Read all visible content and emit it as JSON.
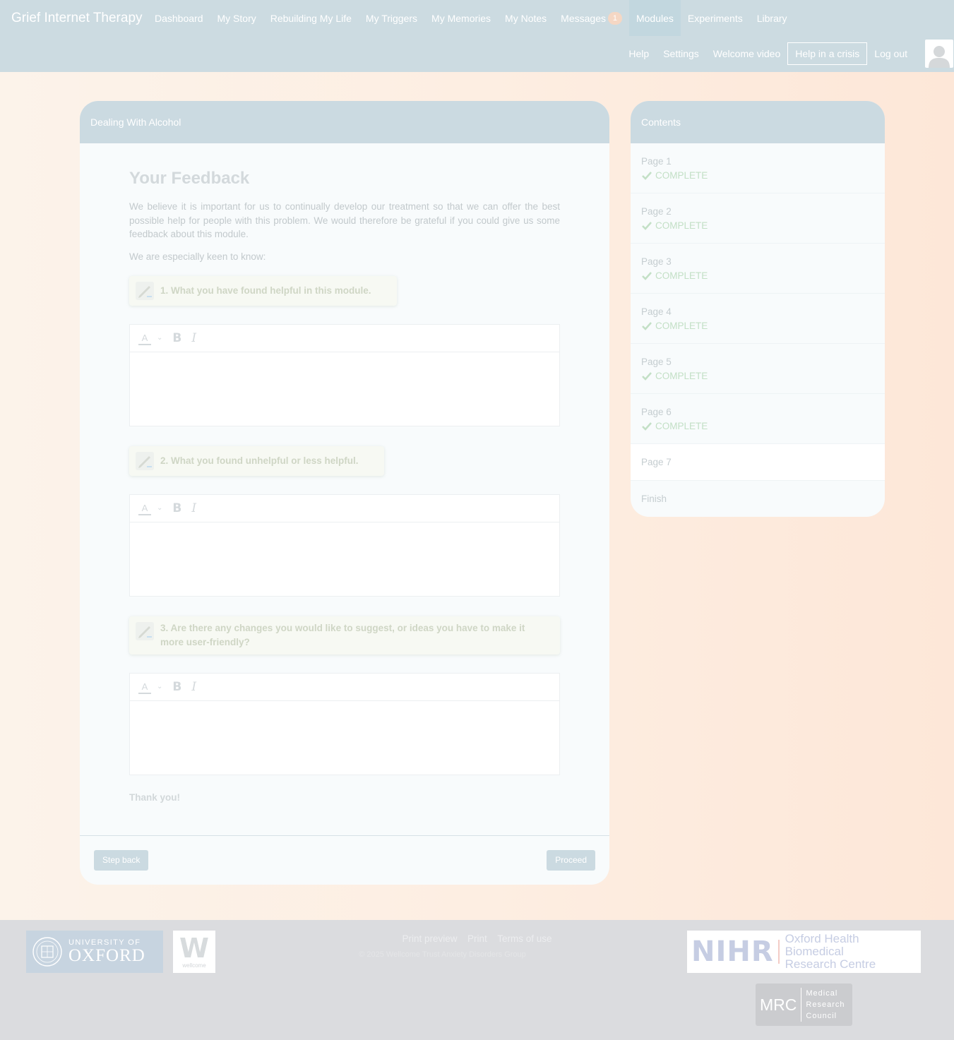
{
  "header": {
    "brand": "Grief Internet Therapy",
    "nav": [
      {
        "label": "Dashboard"
      },
      {
        "label": "My Story"
      },
      {
        "label": "Rebuilding My Life"
      },
      {
        "label": "My Triggers"
      },
      {
        "label": "My Memories"
      },
      {
        "label": "My Notes"
      },
      {
        "label": "Messages",
        "badge": "1"
      },
      {
        "label": "Modules",
        "active": true
      },
      {
        "label": "Experiments"
      },
      {
        "label": "Library"
      }
    ],
    "subnav": [
      {
        "label": "Help"
      },
      {
        "label": "Settings"
      },
      {
        "label": "Welcome video"
      },
      {
        "label": "Help in a crisis"
      },
      {
        "label": "Log out"
      }
    ]
  },
  "module": {
    "title": "Dealing With Alcohol",
    "page_title": "Your Feedback",
    "intro": "We believe it is important for us to continually develop our treatment so that we can offer the best possible help for people with this problem. We would therefore be grateful if you could give us some feedback about this module.",
    "keen": "We are especially keen to know:",
    "questions": [
      {
        "text": "1. What you have found helpful in this module."
      },
      {
        "text": "2. What you found unhelpful or less helpful."
      },
      {
        "text": "3. Are there any changes you would like to suggest, or ideas you have to make it more user-friendly?"
      }
    ],
    "toolbar": {
      "color_label": "A",
      "bold_label": "B",
      "italic_label": "I"
    },
    "thanks": "Thank you!",
    "back_label": "Step back",
    "proceed_label": "Proceed"
  },
  "contents": {
    "title": "Contents",
    "items": [
      {
        "label": "Page 1",
        "status": "COMPLETE"
      },
      {
        "label": "Page 2",
        "status": "COMPLETE"
      },
      {
        "label": "Page 3",
        "status": "COMPLETE"
      },
      {
        "label": "Page 4",
        "status": "COMPLETE"
      },
      {
        "label": "Page 5",
        "status": "COMPLETE"
      },
      {
        "label": "Page 6",
        "status": "COMPLETE"
      },
      {
        "label": "Page 7"
      },
      {
        "label": "Finish"
      }
    ]
  },
  "footer": {
    "links": [
      "Print preview",
      "Print",
      "Terms of use"
    ],
    "copyright": "© 2025 Wellcome Trust Anxiety Disorders Group",
    "oxford": {
      "line1": "UNIVERSITY OF",
      "line2": "OXFORD"
    },
    "wellcome": {
      "mark": "W",
      "text": "wellcome"
    },
    "nihr": {
      "mark": "NIHR",
      "line1": "Oxford Health Biomedical",
      "line2": "Research Centre"
    },
    "mrc": {
      "mark": "MRC",
      "line1": "Medical",
      "line2": "Research",
      "line3": "Council"
    }
  },
  "colors": {
    "header_bg": "#ccdbe1",
    "accent": "#cbdae1",
    "complete": "#c3e0c6",
    "badge": "#f5d7c4"
  }
}
